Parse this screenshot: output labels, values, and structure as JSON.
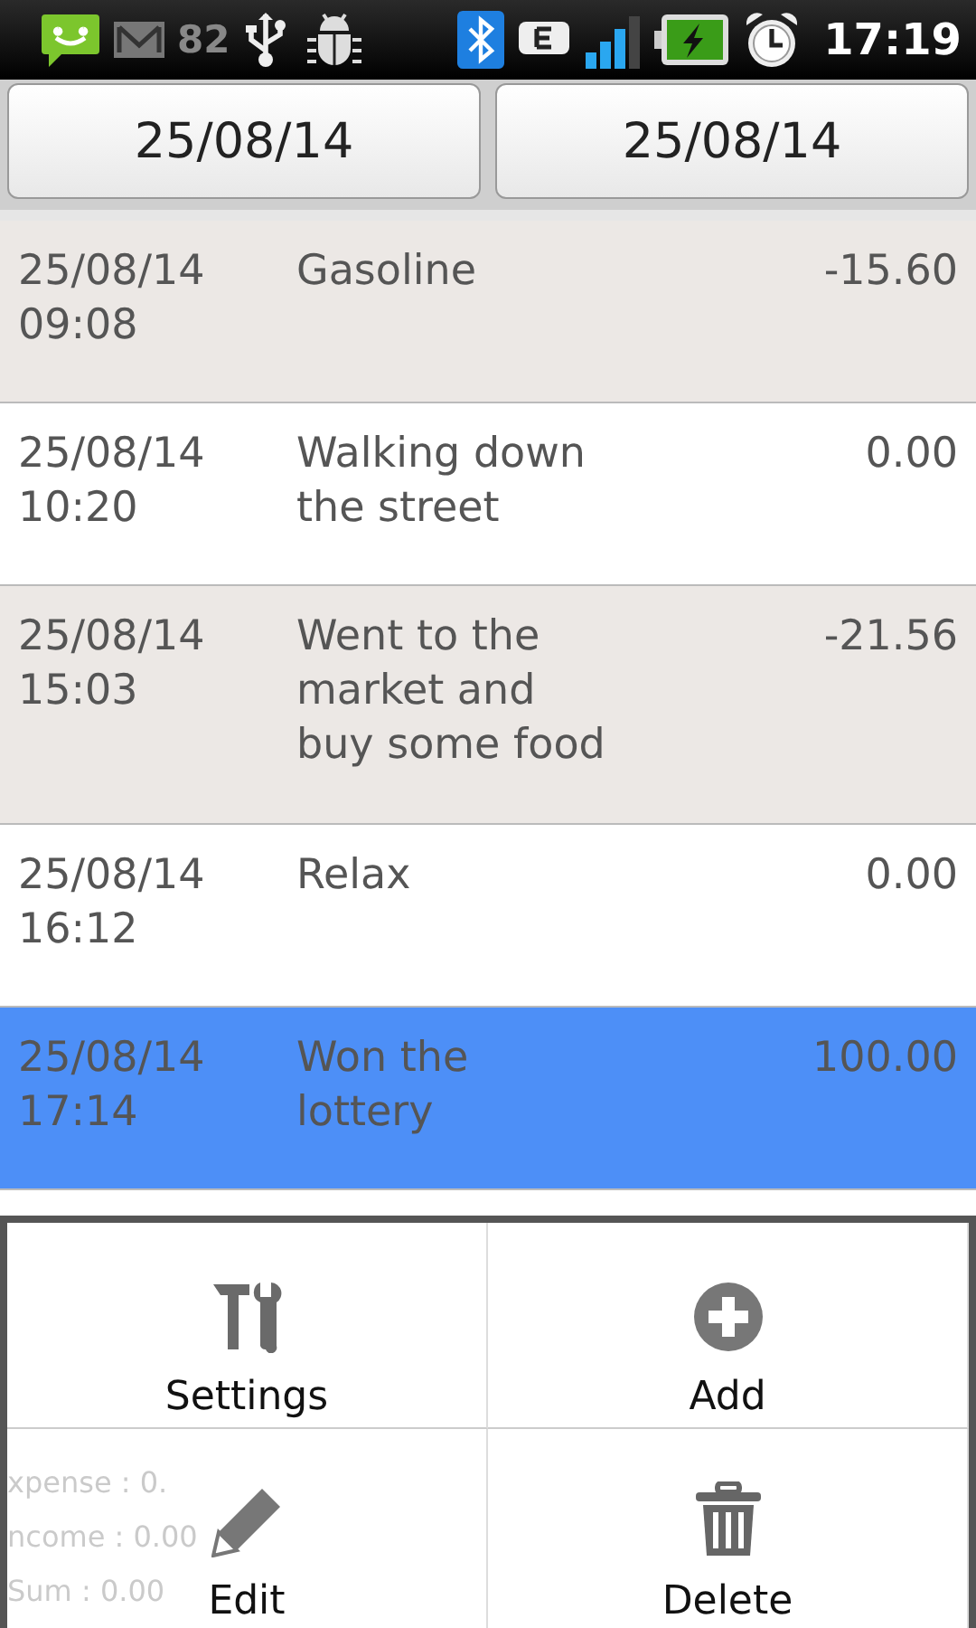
{
  "status_bar": {
    "count": "82",
    "time": "17:19"
  },
  "date_range": {
    "from": "25/08/14",
    "to": "25/08/14"
  },
  "entries": [
    {
      "date": "25/08/14",
      "time": "09:08",
      "description": "Gasoline",
      "amount": "-15.60",
      "selected": false
    },
    {
      "date": "25/08/14",
      "time": "10:20",
      "description": "Walking down the street",
      "amount": "0.00",
      "selected": false
    },
    {
      "date": "25/08/14",
      "time": "15:03",
      "description": "Went to the market and buy some food",
      "amount": "-21.56",
      "selected": false
    },
    {
      "date": "25/08/14",
      "time": "16:12",
      "description": "Relax",
      "amount": "0.00",
      "selected": false
    },
    {
      "date": "25/08/14",
      "time": "17:14",
      "description": "Won the lottery",
      "amount": "100.00",
      "selected": true
    }
  ],
  "summary": [
    "xpense : 0.",
    "ncome : 0.00",
    "Sum : 0.00"
  ],
  "menu": [
    {
      "kind": "settings",
      "label": "Settings"
    },
    {
      "kind": "add",
      "label": "Add"
    },
    {
      "kind": "edit",
      "label": "Edit"
    },
    {
      "kind": "delete",
      "label": "Delete"
    }
  ]
}
